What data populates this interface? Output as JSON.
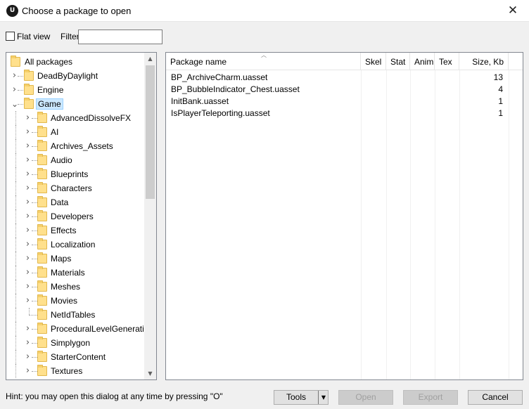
{
  "window": {
    "title": "Choose a package to open",
    "app_icon_text": "U",
    "close_glyph": "✕"
  },
  "toolbar": {
    "flat_view_label": "Flat view",
    "flat_view_checked": false,
    "filter_label": "Filter:",
    "filter_value": ""
  },
  "tree": {
    "root_label": "All packages",
    "top_items": [
      {
        "label": "DeadByDaylight",
        "expanded": false
      },
      {
        "label": "Engine",
        "expanded": false
      },
      {
        "label": "Game",
        "expanded": true,
        "selected": true
      }
    ],
    "game_children": [
      {
        "label": "AdvancedDissolveFX",
        "has_children": true
      },
      {
        "label": "AI",
        "has_children": true
      },
      {
        "label": "Archives_Assets",
        "has_children": true
      },
      {
        "label": "Audio",
        "has_children": true
      },
      {
        "label": "Blueprints",
        "has_children": true
      },
      {
        "label": "Characters",
        "has_children": true
      },
      {
        "label": "Data",
        "has_children": true
      },
      {
        "label": "Developers",
        "has_children": true
      },
      {
        "label": "Effects",
        "has_children": true
      },
      {
        "label": "Localization",
        "has_children": true
      },
      {
        "label": "Maps",
        "has_children": true
      },
      {
        "label": "Materials",
        "has_children": true
      },
      {
        "label": "Meshes",
        "has_children": true
      },
      {
        "label": "Movies",
        "has_children": true
      },
      {
        "label": "NetIdTables",
        "has_children": false
      },
      {
        "label": "ProceduralLevelGeneration",
        "has_children": true
      },
      {
        "label": "Simplygon",
        "has_children": true
      },
      {
        "label": "StarterContent",
        "has_children": true
      },
      {
        "label": "Textures",
        "has_children": true
      }
    ]
  },
  "list": {
    "columns": [
      "Package name",
      "Skel",
      "Stat",
      "Anim",
      "Tex",
      "Size, Kb"
    ],
    "sorted_column": "Package name",
    "rows": [
      {
        "name": "BP_ArchiveCharm.uasset",
        "size": "13"
      },
      {
        "name": "BP_BubbleIndicator_Chest.uasset",
        "size": "4"
      },
      {
        "name": "InitBank.uasset",
        "size": "1"
      },
      {
        "name": "IsPlayerTeleporting.uasset",
        "size": "1"
      }
    ]
  },
  "footer": {
    "hint": "Hint: you may open this dialog at any time by pressing \"O\"",
    "tools_label": "Tools",
    "open_label": "Open",
    "export_label": "Export",
    "cancel_label": "Cancel"
  }
}
